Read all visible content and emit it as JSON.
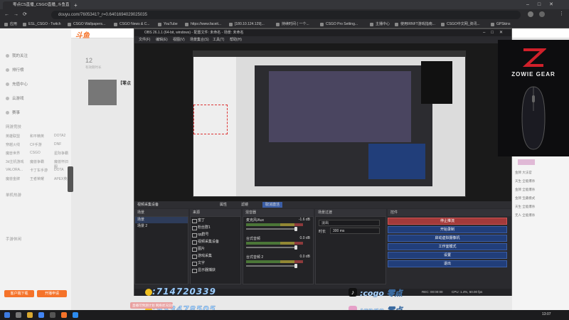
{
  "browser": {
    "tabs": [
      {
        "label": "零点CS直播_CSGO直播_斗鱼直播"
      }
    ],
    "url": "douyu.com/7605341?_r=0.6401694029025035",
    "bookmarks": [
      "应用",
      "ESL_CSGO - Twitch",
      "CSGO Wallpapers...",
      "CSGO News & C...",
      "YouTube",
      "https://www.faceit...",
      "[180.10.124.129]...",
      "持续时间 ( 一个...",
      "CSGO Pro Setting...",
      "主播中心",
      "使用IRNFT游戏指南...",
      "CSGO中文网_资讯...",
      "GPSkins"
    ]
  },
  "douyu": {
    "logo": "斗鱼",
    "count_num": "12",
    "count_label": "有效期时长",
    "room_title": "【零点",
    "nav_items": [
      "我的关注",
      "排行榜",
      "充值中心",
      "云游戏",
      "赛事"
    ],
    "section_recommend": "网游竞技",
    "categories": [
      [
        "英雄联盟",
        "和平精英",
        "DOTA2"
      ],
      [
        "穿越火线",
        "CF手游",
        "DNF"
      ],
      [
        "魔兽世界",
        "CSGO",
        "星际争霸"
      ],
      [
        "3d主机游戏",
        "魔兽争霸",
        "魔兽怀旧服"
      ],
      [
        "VALORA...",
        "卡丁车手游",
        "DOTA"
      ],
      [
        "魔兽金牌",
        "王者荣耀",
        "APEX英雄"
      ]
    ],
    "section_pc": "单机热游",
    "section_mobile": "手游休闲",
    "footer_buttons": [
      "客户端下载",
      "开播申请"
    ],
    "right_items": [
      "金牌 大法官",
      "天生 全能爆杀",
      "金牌 全能爆杀",
      "金牌 宝藏模式",
      "天生 全能爆杀",
      "无人 全能爆杀"
    ]
  },
  "obs": {
    "title": "OBS 26.1.1 (64-bit, windows) - 配置文件: 未命名 - 场景: 未命名",
    "menu": [
      "文件(F)",
      "编辑(E)",
      "视图(V)",
      "场景集合(S)",
      "工具(T)",
      "帮助(H)"
    ],
    "toolbar": {
      "source_name": "视频采集设备",
      "properties": "属性",
      "filters": "滤镜",
      "activate": "取消激活"
    },
    "docks": {
      "scenes": "场景",
      "sources": "来源",
      "mixer": "混音器",
      "transitions": "场景过渡",
      "controls": "控件"
    },
    "scenes": [
      "场景",
      "场景 2"
    ],
    "sources": [
      "蜜丁",
      "粉丝群1",
      "qq群号",
      "视频采集设备",
      "图片",
      "游戏采集",
      "文字",
      "显示器捕获"
    ],
    "mixer": [
      {
        "name": "麦克风/Aux",
        "db": "-1.6 dB"
      },
      {
        "name": "台式音频",
        "db": "0.0 dB"
      },
      {
        "name": "台式音频 2",
        "db": "0.0 dB"
      }
    ],
    "transition": {
      "type": "淡出",
      "duration_label": "时长",
      "duration_value": "300 ms"
    },
    "controls": [
      "停止推流",
      "开始录制",
      "启动虚拟摄像机",
      "工作室模式",
      "设置",
      "退出"
    ],
    "status": {
      "rec": "REC: 00:00:00",
      "cpu": "CPU: 1.4%, 60.00 fps",
      "live": "LIVE: 00:07:42"
    }
  },
  "overlay": {
    "brand": "ZOWIE GEAR",
    "qq1": ":714720339",
    "qq2": ":933478505",
    "tiktok1": ":cogo 零点",
    "tiktok2": ":cogo 零点",
    "notif": "直播可预测计划 网络状况良好"
  },
  "taskbar": {
    "time": "13:07",
    "date": "2021/2/..."
  },
  "colors": {
    "accent_orange": "#f5732a",
    "obs_blue": "#213e7a",
    "obs_red": "#a33a3a",
    "zowie_red": "#d0202a"
  }
}
